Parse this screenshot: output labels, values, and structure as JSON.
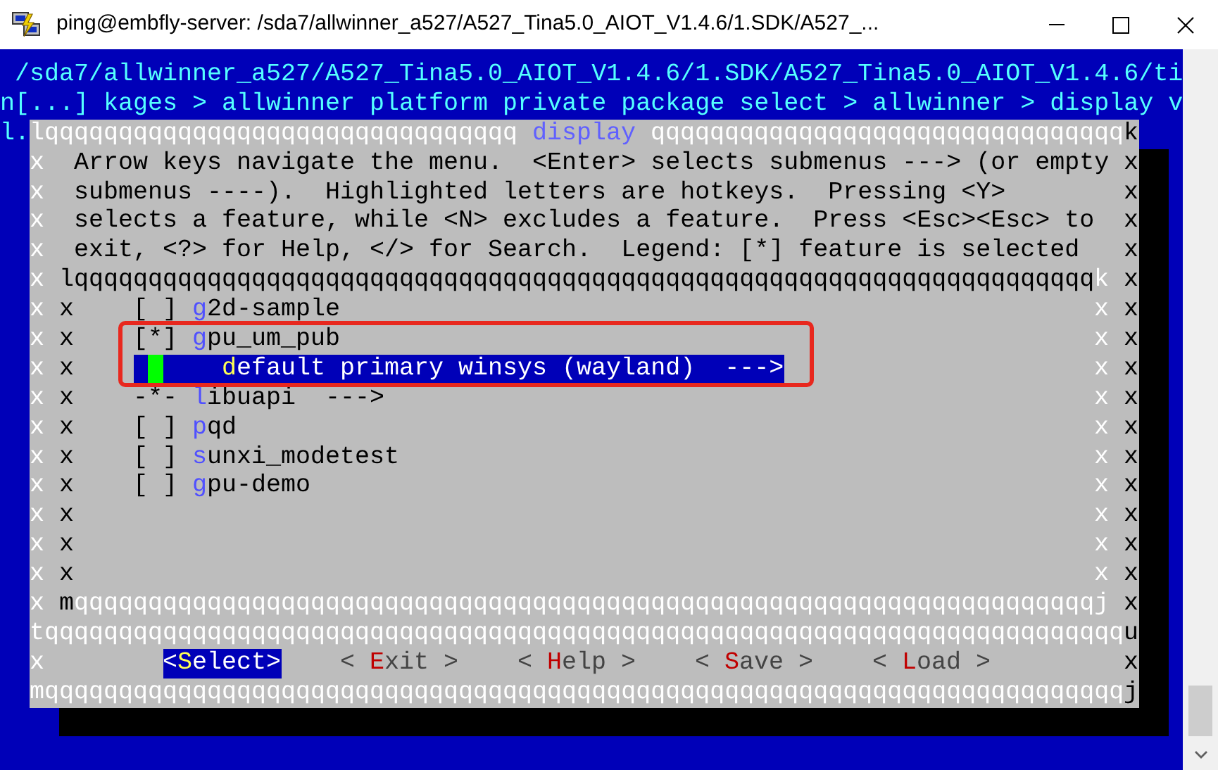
{
  "window": {
    "title": "ping@embfly-server: /sda7/allwinner_a527/A527_Tina5.0_AIOT_V1.4.6/1.SDK/A527_..."
  },
  "window_controls": [
    {
      "kind": "minimize"
    },
    {
      "kind": "maximize"
    },
    {
      "kind": "close"
    }
  ],
  "terminal": {
    "lines": [
      {
        "segments": [
          {
            "kind": "heading",
            "text": "/sda7/allwinner_a527/A527_Tina5.0_AIOT_V1.4.6/1.SDK/A527_Tina5.0_AIOT_V1.4.6/ti"
          }
        ]
      },
      {
        "segments": [
          {
            "kind": "path",
            "text": "n[...] kages > allwinner platform private package select > allwinner > display v"
          }
        ]
      },
      {
        "segments": [
          {
            "kind": "path",
            "text": "l."
          },
          {
            "kind": "outer-left",
            "text": "lqqqqqqqqqqqqqqqqqqqqqqqqqqqqqqqq"
          },
          {
            "kind": "caption",
            "text": "display"
          },
          {
            "kind": "frame-light",
            "text": "qqqqqqqqqqqqqqqqqqqqqqqqqqqqqqqq"
          },
          {
            "kind": "outer-right",
            "text": "k"
          }
        ]
      },
      {
        "segments": [
          {
            "kind": "outer-left",
            "text": "x"
          },
          {
            "kind": "help",
            "text": "Arrow keys navigate the menu.  <Enter> selects submenus ---> (or empty"
          },
          {
            "kind": "outer-right",
            "text": "x"
          }
        ]
      },
      {
        "segments": [
          {
            "kind": "outer-left",
            "text": "x"
          },
          {
            "kind": "help",
            "text": "submenus ----).  Highlighted letters are hotkeys.  Pressing <Y>"
          },
          {
            "kind": "outer-right",
            "text": "x"
          }
        ]
      },
      {
        "segments": [
          {
            "kind": "outer-left",
            "text": "x"
          },
          {
            "kind": "help",
            "text": "selects a feature, while <N> excludes a feature.  Press <Esc><Esc> to"
          },
          {
            "kind": "outer-right",
            "text": "x"
          }
        ]
      },
      {
        "segments": [
          {
            "kind": "outer-left",
            "text": "x"
          },
          {
            "kind": "help",
            "text": "exit, <?> for Help, </> for Search.  Legend: [*] feature is selected"
          },
          {
            "kind": "outer-right",
            "text": "x"
          }
        ]
      },
      {
        "segments": [
          {
            "kind": "outer-left",
            "text": "x"
          },
          {
            "kind": "inner-left",
            "text": "lqqqqqqqqqqqqqqqqqqqqqqqqqqqqqqqqqqqqqqqqqqqqqqqqqqqqqqqqqqqqqqqqqqqqq"
          },
          {
            "kind": "inner-right",
            "text": "k"
          },
          {
            "kind": "outer-right",
            "text": "x"
          }
        ]
      },
      {
        "segments": [
          {
            "kind": "outer-left",
            "text": "x"
          },
          {
            "kind": "inner-left",
            "text": "x"
          },
          {
            "kind": "entry",
            "choice": false,
            "mark": "[ ]",
            "label": "**g**2d-sample",
            "selected": false
          },
          {
            "kind": "inner-right",
            "text": "x"
          },
          {
            "kind": "outer-right",
            "text": "x"
          }
        ]
      },
      {
        "segments": [
          {
            "kind": "outer-left",
            "text": "x"
          },
          {
            "kind": "inner-left",
            "text": "x"
          },
          {
            "kind": "entry",
            "choice": false,
            "mark": "[*]",
            "label": "**g**pu_um_pub",
            "selected": false
          },
          {
            "kind": "inner-right",
            "text": "x"
          },
          {
            "kind": "outer-right",
            "text": "x"
          }
        ]
      },
      {
        "segments": [
          {
            "kind": "outer-left",
            "text": "x"
          },
          {
            "kind": "inner-left",
            "text": "x"
          },
          {
            "kind": "entry",
            "choice": true,
            "label": "**d**efault primary winsys (wayland)  --->",
            "selected": true
          },
          {
            "kind": "inner-right",
            "text": "x"
          },
          {
            "kind": "outer-right",
            "text": "x"
          }
        ]
      },
      {
        "segments": [
          {
            "kind": "outer-left",
            "text": "x"
          },
          {
            "kind": "inner-left",
            "text": "x"
          },
          {
            "kind": "entry",
            "choice": false,
            "mark": "-*-",
            "label": "**l**ibuapi  --->",
            "selected": false
          },
          {
            "kind": "inner-right",
            "text": "x"
          },
          {
            "kind": "outer-right",
            "text": "x"
          }
        ]
      },
      {
        "segments": [
          {
            "kind": "outer-left",
            "text": "x"
          },
          {
            "kind": "inner-left",
            "text": "x"
          },
          {
            "kind": "entry",
            "choice": false,
            "mark": "[ ]",
            "label": "**p**qd",
            "selected": false
          },
          {
            "kind": "inner-right",
            "text": "x"
          },
          {
            "kind": "outer-right",
            "text": "x"
          }
        ]
      },
      {
        "segments": [
          {
            "kind": "outer-left",
            "text": "x"
          },
          {
            "kind": "inner-left",
            "text": "x"
          },
          {
            "kind": "entry",
            "choice": false,
            "mark": "[ ]",
            "label": "**s**unxi_modetest",
            "selected": false
          },
          {
            "kind": "inner-right",
            "text": "x"
          },
          {
            "kind": "outer-right",
            "text": "x"
          }
        ]
      },
      {
        "segments": [
          {
            "kind": "outer-left",
            "text": "x"
          },
          {
            "kind": "inner-left",
            "text": "x"
          },
          {
            "kind": "entry",
            "choice": false,
            "mark": "[ ]",
            "label": "**g**pu-demo",
            "selected": false
          },
          {
            "kind": "inner-right",
            "text": "x"
          },
          {
            "kind": "outer-right",
            "text": "x"
          }
        ]
      },
      {
        "segments": [
          {
            "kind": "outer-left",
            "text": "x"
          },
          {
            "kind": "inner-left",
            "text": "x"
          },
          {
            "kind": "inner-right",
            "text": "x"
          },
          {
            "kind": "outer-right",
            "text": "x"
          }
        ]
      },
      {
        "segments": [
          {
            "kind": "outer-left",
            "text": "x"
          },
          {
            "kind": "inner-left",
            "text": "x"
          },
          {
            "kind": "inner-right",
            "text": "x"
          },
          {
            "kind": "outer-right",
            "text": "x"
          }
        ]
      },
      {
        "segments": [
          {
            "kind": "outer-left",
            "text": "x"
          },
          {
            "kind": "inner-left",
            "text": "x"
          },
          {
            "kind": "inner-right",
            "text": "x"
          },
          {
            "kind": "outer-right",
            "text": "x"
          }
        ]
      },
      {
        "segments": [
          {
            "kind": "outer-left",
            "text": "x"
          },
          {
            "kind": "inner-left",
            "text": "m"
          },
          {
            "kind": "frame-light",
            "text": "qqqqqqqqqqqqqqqqqqqqqqqqqqqqqqqqqqqqqqqqqqqqqqqqqqqqqqqqqqqqqqqqqqqqqj"
          },
          {
            "kind": "outer-right",
            "text": "x"
          }
        ]
      },
      {
        "segments": [
          {
            "kind": "outer-left",
            "text": "t"
          },
          {
            "kind": "frame-light",
            "text": "qqqqqqqqqqqqqqqqqqqqqqqqqqqqqqqqqqqqqqqqqqqqqqqqqqqqqqqqqqqqqqqqqqqqqqqqq"
          },
          {
            "kind": "outer-right",
            "text": "u"
          }
        ]
      },
      {
        "segments": [
          {
            "kind": "outer-left",
            "text": "x"
          },
          {
            "kind": "button",
            "label": "<**S**elect>",
            "selected": true
          },
          {
            "kind": "button",
            "label": "< **E**xit >",
            "selected": false
          },
          {
            "kind": "button",
            "label": "< **H**elp >",
            "selected": false
          },
          {
            "kind": "button",
            "label": "< **S**ave >",
            "selected": false
          },
          {
            "kind": "button",
            "label": "< **L**oad >",
            "selected": false
          },
          {
            "kind": "outer-right",
            "text": "x"
          }
        ]
      },
      {
        "segments": [
          {
            "kind": "outer-left",
            "text": "m"
          },
          {
            "kind": "frame-light",
            "text": "qqqqqqqqqqqqqqqqqqqqqqqqqqqqqqqqqqqqqqqqqqqqqqqqqqqqqqqqqqqqqqqqqqqqqqqqq"
          },
          {
            "kind": "outer-right",
            "text": "j"
          }
        ]
      }
    ]
  }
}
